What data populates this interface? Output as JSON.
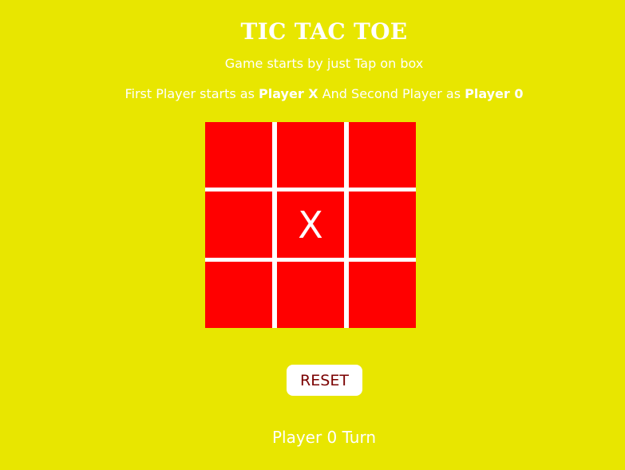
{
  "title": "TIC TAC TOE",
  "subtitle": "Game starts by just Tap on box",
  "info": {
    "prefix": "First Player starts as ",
    "player1": "Player X",
    "middle": " And Second Player as ",
    "player2": "Player 0"
  },
  "board": [
    "",
    "",
    "",
    "",
    "X",
    "",
    "",
    "",
    ""
  ],
  "reset_label": "RESET",
  "turn_text": "Player 0 Turn",
  "colors": {
    "background": "#e8e600",
    "cell": "#ff0000",
    "grid_lines": "#ffffff",
    "text": "#ffffff",
    "reset_text": "#7a0000"
  }
}
